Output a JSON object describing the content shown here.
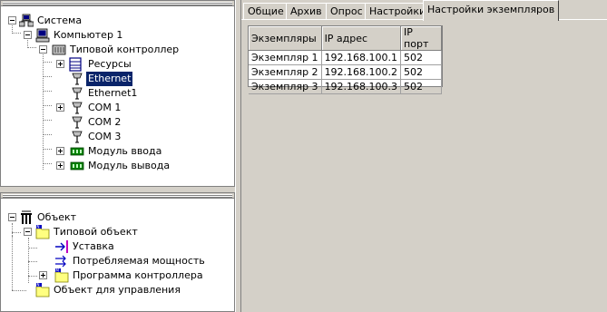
{
  "top_tree": {
    "root": {
      "label": "Система",
      "icon": "network-icon"
    },
    "computer": {
      "label": "Компьютер 1",
      "icon": "computer-icon"
    },
    "controller": {
      "label": "Типовой контроллер",
      "icon": "controller-icon"
    },
    "items": [
      {
        "label": "Ресурсы",
        "icon": "resources-icon"
      },
      {
        "label": "Ethernet",
        "icon": "ethernet-icon",
        "selected": true
      },
      {
        "label": "Ethernet1",
        "icon": "ethernet-icon"
      },
      {
        "label": "COM 1",
        "icon": "port-icon"
      },
      {
        "label": "COM 2",
        "icon": "port-icon"
      },
      {
        "label": "COM 3",
        "icon": "port-icon"
      },
      {
        "label": "Модуль ввода",
        "icon": "module-icon"
      },
      {
        "label": "Модуль вывода",
        "icon": "module-icon"
      }
    ]
  },
  "bottom_tree": {
    "root": {
      "label": "Объект",
      "icon": "object-icon"
    },
    "typical_object": {
      "label": "Типовой объект",
      "icon": "folder-icon"
    },
    "children": [
      {
        "label": "Уставка",
        "icon": "setpoint-icon"
      },
      {
        "label": "Потребляемая мощность",
        "icon": "power-icon"
      },
      {
        "label": "Программа контроллера",
        "icon": "program-folder-icon"
      }
    ],
    "managed_object": {
      "label": "Объект для управления",
      "icon": "folder-icon"
    }
  },
  "tabs": [
    "Общие",
    "Архив",
    "Опрос",
    "Настройки",
    "Настройки экземпляров"
  ],
  "grid": {
    "columns": [
      "Экземпляры",
      "IP адрес",
      "IP порт"
    ],
    "rows": [
      [
        "Экземпляр 1",
        "192.168.100.1",
        "502"
      ],
      [
        "Экземпляр 2",
        "192.168.100.2",
        "502"
      ],
      [
        "Экземпляр 3",
        "192.168.100.3",
        "502"
      ]
    ]
  }
}
